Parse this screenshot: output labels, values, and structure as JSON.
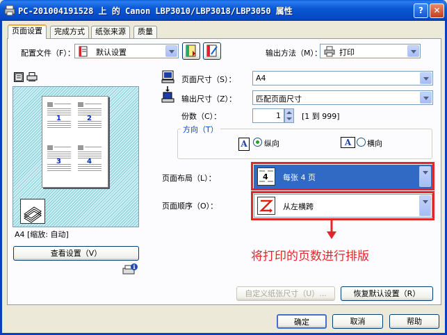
{
  "window": {
    "title": "PC-201004191528 上 的 Canon LBP3010/LBP3018/LBP3050 属性"
  },
  "tabs": [
    {
      "label": "页面设置"
    },
    {
      "label": "完成方式"
    },
    {
      "label": "纸张来源"
    },
    {
      "label": "质量"
    }
  ],
  "profile": {
    "label": "配置文件（F）：",
    "value": "默认设置"
  },
  "output_method": {
    "label": "输出方法（M）：",
    "value": "打印"
  },
  "preview": {
    "status": "A4 [缩放: 自动]",
    "view_settings_label": "查看设置（V）",
    "page_numbers": [
      "1",
      "2",
      "3",
      "4"
    ]
  },
  "page_size": {
    "label": "页面尺寸（S）：",
    "value": "A4"
  },
  "output_size": {
    "label": "输出尺寸（Z）：",
    "value": "匹配页面尺寸"
  },
  "copies": {
    "label": "份数（C）：",
    "value": "1",
    "range": "[1 到 999]"
  },
  "orientation": {
    "title": "方向（T）",
    "portrait": "纵向",
    "landscape": "横向",
    "selected": "portrait"
  },
  "page_layout": {
    "label": "页面布局（L）：",
    "value": "每张 4 页"
  },
  "page_order": {
    "label": "页面顺序（O）：",
    "value": "从左横跨"
  },
  "annotation": "将打印的页数进行排版",
  "custom_paper_label": "自定义纸张尺寸（U）...",
  "restore_defaults_label": "恢复默认设置（R）",
  "footer": {
    "ok": "确定",
    "cancel": "取消",
    "help": "帮助"
  },
  "colors": {
    "selection": "#316ac5",
    "annotation": "#e2262a",
    "titlebar": "#0548c6"
  }
}
